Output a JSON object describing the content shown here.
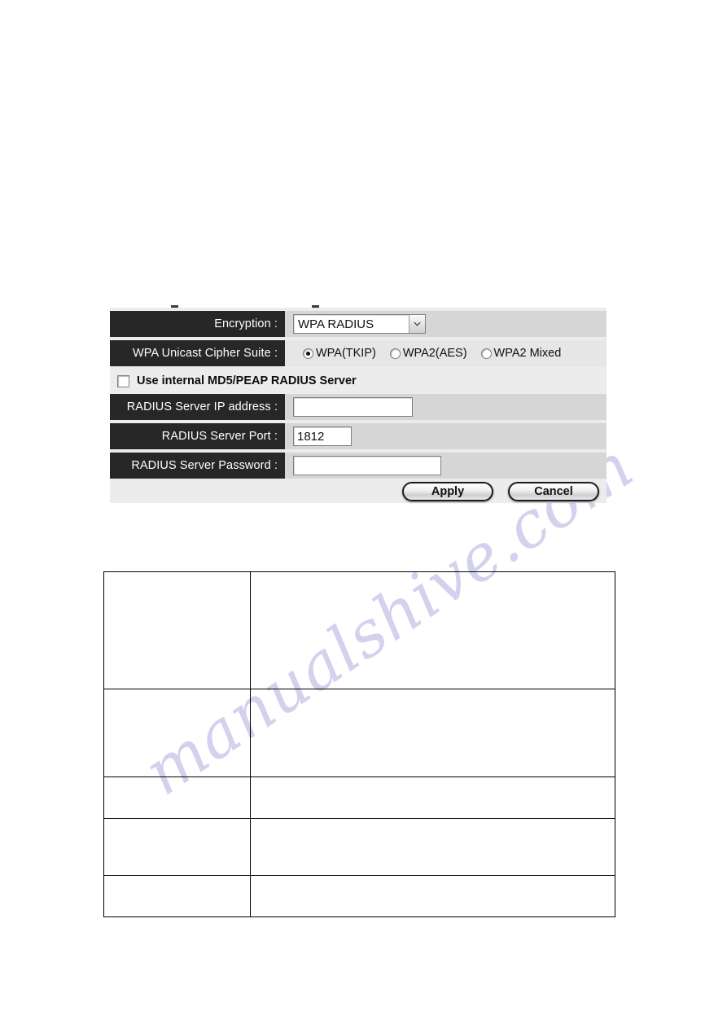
{
  "watermark": {
    "text": "manualshive.com"
  },
  "panel": {
    "rows": {
      "encryption": {
        "label": "Encryption :",
        "select_value": "WPA RADIUS",
        "arrow_icon": "chevron-down-icon"
      },
      "cipher": {
        "label": "WPA Unicast Cipher Suite :",
        "options": [
          {
            "label": "WPA(TKIP)",
            "selected": true
          },
          {
            "label": "WPA2(AES)",
            "selected": false
          },
          {
            "label": "WPA2 Mixed",
            "selected": false
          }
        ]
      },
      "internal_radius": {
        "label": "Use internal MD5/PEAP RADIUS Server",
        "checked": false
      },
      "server_ip": {
        "label": "RADIUS Server IP address :",
        "value": ""
      },
      "server_port": {
        "label": "RADIUS Server Port :",
        "value": "1812"
      },
      "server_password": {
        "label": "RADIUS Server Password :",
        "value": ""
      }
    },
    "buttons": {
      "apply": "Apply",
      "cancel": "Cancel"
    }
  },
  "description_table": {
    "rows": [
      {
        "name": "",
        "description": ""
      },
      {
        "name": "",
        "description": ""
      },
      {
        "name": "",
        "description": ""
      },
      {
        "name": "",
        "description": ""
      },
      {
        "name": "",
        "description": ""
      }
    ]
  },
  "colors": {
    "label_block": "#272727",
    "panel_bg": "#ececec",
    "row_alt": "#d6d6d6",
    "watermark": "#b9b8e4",
    "button_border": "#1c1c1c"
  }
}
